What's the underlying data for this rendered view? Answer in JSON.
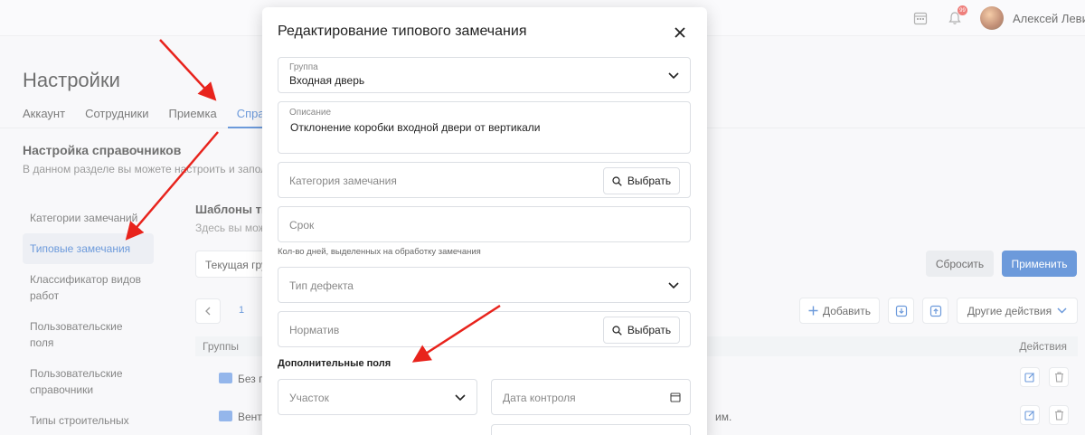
{
  "header": {
    "user_name": "Алексей Левин",
    "notification_count": "99"
  },
  "page": {
    "title": "Настройки",
    "tabs": [
      {
        "label": "Аккаунт"
      },
      {
        "label": "Сотрудники"
      },
      {
        "label": "Приемка"
      },
      {
        "label": "Справо"
      }
    ],
    "section_title": "Настройка справочников",
    "section_desc": "В данном разделе вы можете настроить и запол"
  },
  "sidebar": {
    "items": [
      {
        "label": "Категории замечаний"
      },
      {
        "label": "Типовые замечания"
      },
      {
        "label": "Классификатор видов работ"
      },
      {
        "label": "Пользовательские поля"
      },
      {
        "label": "Пользовательские справочники"
      },
      {
        "label": "Типы строительных"
      }
    ]
  },
  "content": {
    "title": "Шаблоны ти",
    "desc": "Здесь вы мож",
    "filter_value": "Текущая гру",
    "reset_label": "Сбросить",
    "apply_label": "Применить",
    "page_number": "1",
    "add_label": "Добавить",
    "more_label": "Другие действия",
    "col_groups": "Группы",
    "col_actions": "Действия",
    "rows": [
      {
        "name": "Без г",
        "desc": ""
      },
      {
        "name": "Вент",
        "desc": "им."
      }
    ]
  },
  "modal": {
    "title": "Редактирование типового замечания",
    "group_label": "Группа",
    "group_value": "Входная дверь",
    "desc_label": "Описание",
    "desc_value": "Отклонение коробки входной двери от вертикали",
    "category_placeholder": "Категория замечания",
    "pick_label": "Выбрать",
    "term_placeholder": "Срок",
    "term_hint": "Кол-во дней, выделенных на обработку замечания",
    "defect_placeholder": "Тип дефекта",
    "norm_placeholder": "Норматив",
    "pick_label_2": "Выбрать",
    "extra_title": "Дополнительные поля",
    "area_placeholder": "Участок",
    "control_date_placeholder": "Дата контроля"
  },
  "colors": {
    "accent": "#1e64c8",
    "arrow": "#e8231c"
  }
}
